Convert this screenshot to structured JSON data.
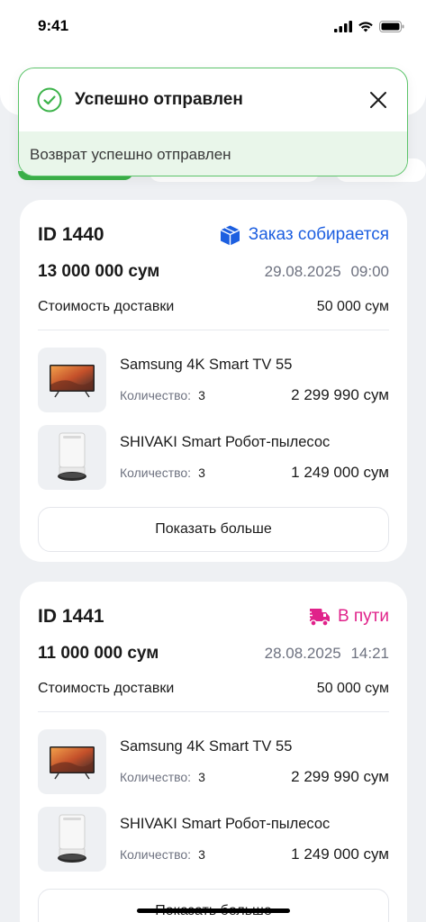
{
  "status_bar": {
    "time": "9:41"
  },
  "toast": {
    "title": "Успешно отправлен",
    "message": "Возврат успешно отправлен",
    "accent": "#3cb34a"
  },
  "orders": [
    {
      "id": "ID 1440",
      "status": "Заказ собирается",
      "status_color": "#1d5fe0",
      "status_icon": "box-icon",
      "amount": "13 000 000 сум",
      "date": "29.08.2025 09:00",
      "delivery_label": "Стоимость доставки",
      "delivery_price": "50 000 сум",
      "products": [
        {
          "name": "Samsung 4K Smart TV 55",
          "qty_label": "Количество:",
          "qty": "3",
          "price": "2 299 990 сум"
        },
        {
          "name": "SHIVAKI Smart Робот-пылесос",
          "qty_label": "Количество:",
          "qty": "3",
          "price": "1 249 000 сум"
        }
      ],
      "show_more": "Показать больше"
    },
    {
      "id": "ID 1441",
      "status": "В пути",
      "status_color": "#e0228a",
      "status_icon": "delivery-truck-icon",
      "amount": "11 000 000 сум",
      "date": "28.08.2025 14:21",
      "delivery_label": "Стоимость доставки",
      "delivery_price": "50 000 сум",
      "products": [
        {
          "name": "Samsung 4K Smart TV 55",
          "qty_label": "Количество:",
          "qty": "3",
          "price": "2 299 990 сум"
        },
        {
          "name": "SHIVAKI Smart Робот-пылесос",
          "qty_label": "Количество:",
          "qty": "3",
          "price": "1 249 000 сум"
        }
      ],
      "show_more": "Показать больше"
    }
  ]
}
